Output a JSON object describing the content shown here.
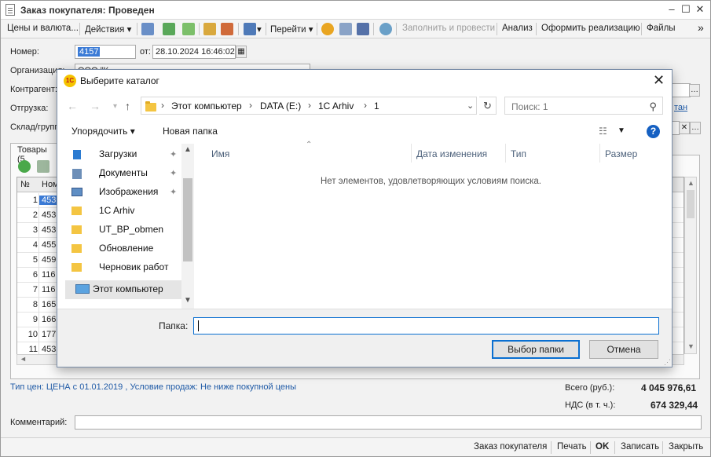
{
  "window": {
    "title": "Заказ покупателя: Проведен"
  },
  "toolbar": {
    "prices": "Цены и валюта...",
    "actions": "Действия",
    "go": "Перейти",
    "fill_and_post": "Заполнить и провести",
    "analysis": "Анализ",
    "issue_sale": "Оформить реализацию",
    "files": "Файлы",
    "more": "»"
  },
  "header": {
    "number_label": "Номер:",
    "number_value": "4157",
    "date_label": "от:",
    "date_value": "28.10.2024 16:46:02",
    "org_label": "Организация:",
    "org_value": "ООО \"К...",
    "counterparty_label": "Контрагент:",
    "shipment_label": "Отгрузка:",
    "shipment_link": "тан",
    "warehouse_label": "Склад/группа:"
  },
  "tabs": {
    "goods": "Товары (5"
  },
  "grid": {
    "col_num": "№",
    "col_nom": "Ном",
    "rows": [
      {
        "n": "1",
        "v": "453"
      },
      {
        "n": "2",
        "v": "453"
      },
      {
        "n": "3",
        "v": "453"
      },
      {
        "n": "4",
        "v": "455"
      },
      {
        "n": "5",
        "v": "459"
      },
      {
        "n": "6",
        "v": "116"
      },
      {
        "n": "7",
        "v": "116"
      },
      {
        "n": "8",
        "v": "165"
      },
      {
        "n": "9",
        "v": "166"
      },
      {
        "n": "10",
        "v": "177"
      },
      {
        "n": "11",
        "v": "453"
      }
    ]
  },
  "footer": {
    "price_info": "Тип цен:  ЦЕНА с 01.01.2019 , Условие продаж: Не ниже покупной цены",
    "total_label": "Всего (руб.):",
    "total_value": "4 045 976,61",
    "vat_label": "НДС (в т. ч.):",
    "vat_value": "674 329,44",
    "comment_label": "Комментарий:"
  },
  "commandbar": {
    "order": "Заказ покупателя",
    "print": "Печать",
    "ok": "OK",
    "save": "Записать",
    "close": "Закрыть"
  },
  "dialog": {
    "title": "Выберите каталог",
    "breadcrumb": [
      "Этот компьютер",
      "DATA (E:)",
      "1C Arhiv",
      "1"
    ],
    "search_placeholder": "Поиск: 1",
    "organize": "Упорядочить",
    "new_folder": "Новая папка",
    "help": "?",
    "nav_items": [
      {
        "label": "Загрузки",
        "icon": "download-icon",
        "pinned": true
      },
      {
        "label": "Документы",
        "icon": "documents-icon",
        "pinned": true
      },
      {
        "label": "Изображения",
        "icon": "images-icon",
        "pinned": true
      },
      {
        "label": "1C Arhiv",
        "icon": "folder-icon",
        "pinned": false
      },
      {
        "label": "UT_BP_obmen",
        "icon": "folder-icon",
        "pinned": false
      },
      {
        "label": "Обновление",
        "icon": "folder-icon",
        "pinned": false
      },
      {
        "label": "Черновик работ",
        "icon": "folder-icon",
        "pinned": false
      }
    ],
    "this_pc": "Этот компьютер",
    "columns": {
      "name": "Имя",
      "modified": "Дата изменения",
      "type": "Тип",
      "size": "Размер"
    },
    "empty_message": "Нет элементов, удовлетворяющих условиям поиска.",
    "folder_label": "Папка:",
    "folder_value": "",
    "select_button": "Выбор папки",
    "cancel_button": "Отмена"
  }
}
